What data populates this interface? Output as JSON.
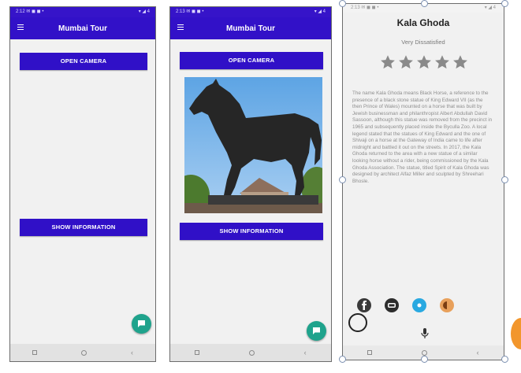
{
  "screens": [
    {
      "status_left": "2:12 ✉ ◼ ◼ •",
      "status_right": "▾ ◢ 4",
      "app_title": "Mumbai Tour",
      "open_camera_label": "OPEN CAMERA",
      "show_info_label": "SHOW INFORMATION"
    },
    {
      "status_left": "2:13 ✉ ◼ ◼ •",
      "status_right": "▾ ◢ 4",
      "app_title": "Mumbai Tour",
      "open_camera_label": "OPEN CAMERA",
      "show_info_label": "SHOW INFORMATION"
    }
  ],
  "detail": {
    "status_left": "2:13 ✉ ◼ ◼ •",
    "status_right": "▾ ◢ 4",
    "title": "Kala Ghoda",
    "subtitle": "Very Dissatisfied",
    "rating": 0,
    "star_count": 5,
    "description": "The name Kala Ghoda means Black Horse, a reference to the presence of a black stone statue of King Edward VII (as the then Prince of Wales) mounted on a horse that was built by Jewish businessman and philanthropist Albert Abdullah David Sassoon, although this statue was removed from the precinct in 1965 and subsequently placed inside the Byculla Zoo. A local legend stated that the statues of King Edward and the one of Shivaji on a horse at the Gateway of India came to life after midnight and battled it out on the streets. In 2017, the Kala Ghoda returned to the area with a new statue of a similar looking horse without a rider, being commissioned by the Kala Ghoda Association. The statue, titled Spirit of Kala Ghoda was designed by architect Alfaz Miller and sculpted by Shreehari Bhosle."
  },
  "colors": {
    "primary": "#3211c8",
    "fab": "#1fa38c",
    "star": "#8a8a8a",
    "background": "#f1f1f1"
  },
  "icons": [
    "menu-icon",
    "chat-icon",
    "star-icon",
    "facebook-icon",
    "github-icon",
    "share-icon",
    "music-icon",
    "mic-icon"
  ]
}
